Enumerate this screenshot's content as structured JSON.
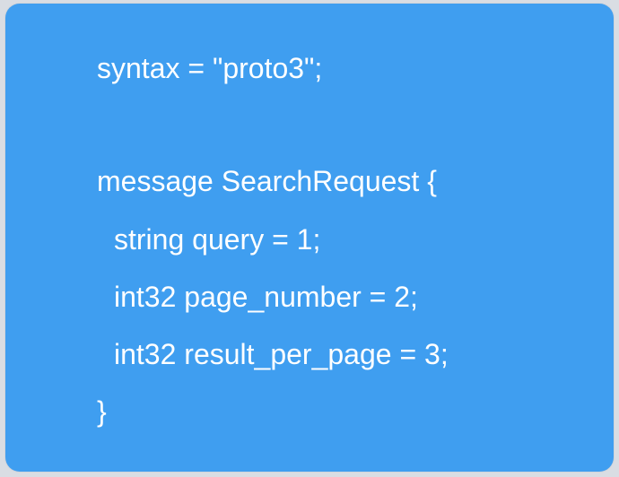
{
  "code": {
    "lines": [
      "syntax = \"proto3\";",
      "message SearchRequest {",
      "string query = 1;",
      "int32 page_number = 2;",
      "int32 result_per_page = 3;",
      "}"
    ]
  },
  "colors": {
    "card_background": "#3f9ef0",
    "text": "#ffffff"
  }
}
